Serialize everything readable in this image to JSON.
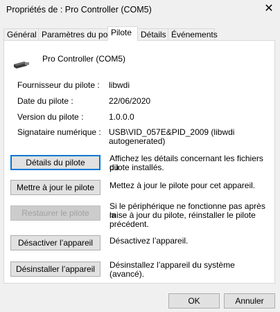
{
  "window": {
    "title": "Propriétés de : Pro Controller (COM5)",
    "close_glyph": "✕"
  },
  "tabs": [
    {
      "label": "Général"
    },
    {
      "label": "Paramètres du port"
    },
    {
      "label": "Pilote"
    },
    {
      "label": "Détails"
    },
    {
      "label": "Événements"
    }
  ],
  "device": {
    "name": "Pro Controller (COM5)",
    "icon": "serial-port-icon"
  },
  "properties": [
    {
      "label": "Fournisseur du pilote :",
      "value": "libwdi"
    },
    {
      "label": "Date du pilote :",
      "value": "22/06/2020"
    },
    {
      "label": "Version du pilote :",
      "value": "1.0.0.0"
    },
    {
      "label": "Signataire numérique :",
      "value_line1": "USB\\VID_057E&PID_2009 (libwdi",
      "value_line2": "autogenerated)"
    }
  ],
  "actions": [
    {
      "label": "Détails du pilote",
      "desc1": "Affichez les détails concernant les fichiers du",
      "desc2": "pilote installés."
    },
    {
      "label": "Mettre à jour le pilote",
      "desc1": "Mettez à jour le pilote pour cet appareil."
    },
    {
      "label": "Restaurer le pilote",
      "desc1": "Si le périphérique ne fonctionne pas après la",
      "desc2": "mise à jour du pilote, réinstaller le pilote",
      "desc3": "précédent."
    },
    {
      "label": "Désactiver l’appareil",
      "desc1": "Désactivez l’appareil."
    },
    {
      "label": "Désinstaller l’appareil",
      "desc1": "Désinstallez l’appareil du système (avancé)."
    }
  ],
  "footer": {
    "ok_label": "OK",
    "cancel_label": "Annuler"
  }
}
